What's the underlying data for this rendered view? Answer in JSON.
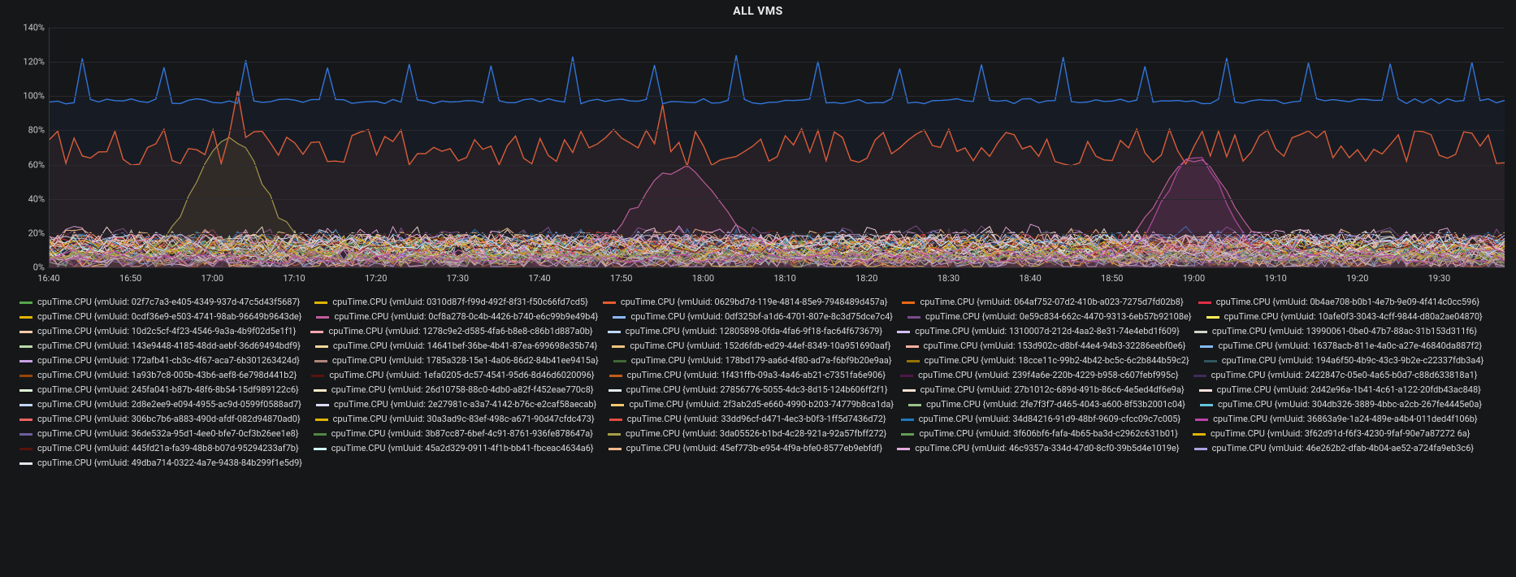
{
  "title": "ALL VMS",
  "chart_data": {
    "type": "line",
    "title": "ALL VMS",
    "xlabel": "",
    "ylabel": "",
    "x_is_time": true,
    "x_ticks": [
      "16:40",
      "16:50",
      "17:00",
      "17:10",
      "17:20",
      "17:30",
      "17:40",
      "17:50",
      "18:00",
      "18:10",
      "18:20",
      "18:30",
      "18:40",
      "18:50",
      "19:00",
      "19:10",
      "19:20",
      "19:30"
    ],
    "y_ticks": [
      "0%",
      "20%",
      "40%",
      "60%",
      "80%",
      "100%",
      "120%",
      "140%"
    ],
    "ylim": [
      0,
      140
    ],
    "xlim_minutes": [
      1000,
      1178
    ],
    "x_minutes": [
      1000,
      1001,
      1002,
      1003,
      1004,
      1005,
      1006,
      1007,
      1008,
      1009,
      1010,
      1011,
      1012,
      1013,
      1014,
      1015,
      1016,
      1017,
      1018,
      1019,
      1020,
      1021,
      1022,
      1023,
      1024,
      1025,
      1026,
      1027,
      1028,
      1029,
      1030,
      1031,
      1032,
      1033,
      1034,
      1035,
      1036,
      1037,
      1038,
      1039,
      1040,
      1041,
      1042,
      1043,
      1044,
      1045,
      1046,
      1047,
      1048,
      1049,
      1050,
      1051,
      1052,
      1053,
      1054,
      1055,
      1056,
      1057,
      1058,
      1059,
      1060,
      1061,
      1062,
      1063,
      1064,
      1065,
      1066,
      1067,
      1068,
      1069,
      1070,
      1071,
      1072,
      1073,
      1074,
      1075,
      1076,
      1077,
      1078,
      1079,
      1080,
      1081,
      1082,
      1083,
      1084,
      1085,
      1086,
      1087,
      1088,
      1089,
      1090,
      1091,
      1092,
      1093,
      1094,
      1095,
      1096,
      1097,
      1098,
      1099,
      1100,
      1101,
      1102,
      1103,
      1104,
      1105,
      1106,
      1107,
      1108,
      1109,
      1110,
      1111,
      1112,
      1113,
      1114,
      1115,
      1116,
      1117,
      1118,
      1119,
      1120,
      1121,
      1122,
      1123,
      1124,
      1125,
      1126,
      1127,
      1128,
      1129,
      1130,
      1131,
      1132,
      1133,
      1134,
      1135,
      1136,
      1137,
      1138,
      1139,
      1140,
      1141,
      1142,
      1143,
      1144,
      1145,
      1146,
      1147,
      1148,
      1149,
      1150,
      1151,
      1152,
      1153,
      1154,
      1155,
      1156,
      1157,
      1158,
      1159,
      1160,
      1161,
      1162,
      1163,
      1164,
      1165,
      1166,
      1167,
      1168,
      1169,
      1170,
      1171,
      1172,
      1173,
      1174,
      1175,
      1176,
      1177,
      1178
    ],
    "series": [
      {
        "name": "cpuTime.CPU {vmUuid: 02f7c7a3-e405-4349-937d-47c5d43f5687}",
        "color": "#56a64b",
        "kind": "blue"
      },
      {
        "name": "cpuTime.CPU {vmUuid: 0310d87f-f99d-492f-8f31-f50c66fd7cd5}",
        "color": "#e0b400",
        "kind": "noise"
      },
      {
        "name": "cpuTime.CPU {vmUuid: 0629bd7d-119e-4814-85e9-7948489d457a}",
        "color": "#e55b2f",
        "kind": "orange"
      },
      {
        "name": "cpuTime.CPU {vmUuid: 064af752-07d2-410b-a023-7275d7fd02b8}",
        "color": "#ea6a17",
        "kind": "noise"
      },
      {
        "name": "cpuTime.CPU {vmUuid: 0b4ae708-b0b1-4e7b-9e09-4f414c0cc596}",
        "color": "#e02f44",
        "kind": "noise"
      },
      {
        "name": "cpuTime.CPU {vmUuid: 0cdf36e9-e503-4741-98ab-96649b9643de}",
        "color": "#e0b400",
        "kind": "noise"
      },
      {
        "name": "cpuTime.CPU {vmUuid: 0cf8a278-0c4b-4426-b740-e6c99b9e49b4}",
        "color": "#c15c9c",
        "kind": "pink"
      },
      {
        "name": "cpuTime.CPU {vmUuid: 0df325bf-a1d6-4701-807e-8c3d75dce7c4}",
        "color": "#8ab8ff",
        "kind": "noise"
      },
      {
        "name": "cpuTime.CPU {vmUuid: 0e59c834-662c-4470-9313-6eb57b92108e}",
        "color": "#7b4b8b",
        "kind": "noise"
      },
      {
        "name": "cpuTime.CPU {vmUuid: 10afe0f3-3043-4cff-9844-d80a2ae04870}",
        "color": "#ffee52",
        "kind": "noise"
      },
      {
        "name": "cpuTime.CPU {vmUuid: 10d2c5cf-4f23-4546-9a3a-4b9f02d5e1f1}",
        "color": "#ffcbad",
        "kind": "noise"
      },
      {
        "name": "cpuTime.CPU {vmUuid: 1278c9e2-d585-4fa6-b8e8-c86b1d887a0b}",
        "color": "#ffa6b0",
        "kind": "noise"
      },
      {
        "name": "cpuTime.CPU {vmUuid: 12805898-0fda-4fa6-9f18-fac64f673679}",
        "color": "#c0d8ff",
        "kind": "noise"
      },
      {
        "name": "cpuTime.CPU {vmUuid: 1310007d-212d-4aa2-8e31-74e4ebd1f609}",
        "color": "#d6bfff",
        "kind": "noise"
      },
      {
        "name": "cpuTime.CPU {vmUuid: 13990061-0be0-47b7-88ac-31b153d311f6}",
        "color": "#d4d4ca",
        "kind": "noise"
      },
      {
        "name": "cpuTime.CPU {vmUuid: 143e9448-4185-48dd-aebf-36d69494bdf9}",
        "color": "#b7dbab",
        "kind": "noise"
      },
      {
        "name": "cpuTime.CPU {vmUuid: 14641bef-36be-4b41-87ea-699698e35b74}",
        "color": "#f4d598",
        "kind": "noise"
      },
      {
        "name": "cpuTime.CPU {vmUuid: 152d6fdb-ed29-44ef-8349-10a951690aaf}",
        "color": "#f4c47e",
        "kind": "noise"
      },
      {
        "name": "cpuTime.CPU {vmUuid: 153d902c-d8bf-44e4-94b3-32286eebf0e6}",
        "color": "#fdaf9f",
        "kind": "noise"
      },
      {
        "name": "cpuTime.CPU {vmUuid: 16378acb-811e-4a0c-a27e-46840da887f2}",
        "color": "#84baf3",
        "kind": "noise"
      },
      {
        "name": "cpuTime.CPU {vmUuid: 172afb41-cb3c-4f67-aca7-6b301263424d}",
        "color": "#c8a1e0",
        "kind": "noise"
      },
      {
        "name": "cpuTime.CPU {vmUuid: 1785a328-15e1-4a06-86d2-84b41ee9415a}",
        "color": "#b0867b",
        "kind": "noise"
      },
      {
        "name": "cpuTime.CPU {vmUuid: 178bd179-aa6d-4f80-ad7a-f6bf9b20e9aa}",
        "color": "#3f6833",
        "kind": "noise"
      },
      {
        "name": "cpuTime.CPU {vmUuid: 18cce11c-99b2-4b42-bc5c-6c2b844b59c2}",
        "color": "#967302",
        "kind": "noise"
      },
      {
        "name": "cpuTime.CPU {vmUuid: 194a6f50-4b9c-43c3-9b2e-c22337fdb3a4}",
        "color": "#2f575e",
        "kind": "noise"
      },
      {
        "name": "cpuTime.CPU {vmUuid: 1a93b7c8-005b-43b6-aef8-6e798d441b2}",
        "color": "#99440a",
        "kind": "noise"
      },
      {
        "name": "cpuTime.CPU {vmUuid: 1efa0205-dc57-4541-95d6-8d46d6020096}",
        "color": "#58140c",
        "kind": "noise"
      },
      {
        "name": "cpuTime.CPU {vmUuid: 1f431ffb-09a3-4a46-ab21-c7351fa6e906}",
        "color": "#c15c17",
        "kind": "noise"
      },
      {
        "name": "cpuTime.CPU {vmUuid: 239f4a6e-220b-4229-b958-c607febf995c}",
        "color": "#511749",
        "kind": "noise"
      },
      {
        "name": "cpuTime.CPU {vmUuid: 2422847c-05e0-4a65-b0d7-c88d633818a1}",
        "color": "#3f2b5b",
        "kind": "noise"
      },
      {
        "name": "cpuTime.CPU {vmUuid: 245fa041-b87b-48f6-8b54-15df989122c6}",
        "color": "#e0f9d7",
        "kind": "noise"
      },
      {
        "name": "cpuTime.CPU {vmUuid: 26d10758-88c0-4db0-a82f-f452eae770c8}",
        "color": "#fceaca",
        "kind": "noise"
      },
      {
        "name": "cpuTime.CPU {vmUuid: 27856776-5055-4dc3-8d15-124b606ff2f1}",
        "color": "#e3eded",
        "kind": "noise"
      },
      {
        "name": "cpuTime.CPU {vmUuid: 27b1012c-689d-491b-86c6-4e5ed4df6e9a}",
        "color": "#f9e2d2",
        "kind": "noise"
      },
      {
        "name": "cpuTime.CPU {vmUuid: 2d42e96a-1b41-4c61-a122-20fdb43ac848}",
        "color": "#fce2de",
        "kind": "noise"
      },
      {
        "name": "cpuTime.CPU {vmUuid: 2d8e2ee9-e094-4955-ac9d-0599f0588ad7}",
        "color": "#bed6f6",
        "kind": "noise"
      },
      {
        "name": "cpuTime.CPU {vmUuid: 2e27981c-a3a7-4142-b76c-e2caf58aecab}",
        "color": "#dedaf7",
        "kind": "noise"
      },
      {
        "name": "cpuTime.CPU {vmUuid: 2f3ab2d5-e660-4990-b203-74779b8ca1da}",
        "color": "#f2c96d",
        "kind": "noise"
      },
      {
        "name": "cpuTime.CPU {vmUuid: 2fe7f3f7-d465-4043-a600-8f53b2001c04}",
        "color": "#9ac48a",
        "kind": "noise"
      },
      {
        "name": "cpuTime.CPU {vmUuid: 304db326-3889-4bbc-a2cb-267fe4445e0a}",
        "color": "#65c5db",
        "kind": "noise"
      },
      {
        "name": "cpuTime.CPU {vmUuid: 306bc7b6-a883-490d-afdf-082d94870ad0}",
        "color": "#ea6460",
        "kind": "noise"
      },
      {
        "name": "cpuTime.CPU {vmUuid: 30a3ad9c-83ef-498c-a671-90d47cfdc473}",
        "color": "#e0b400",
        "kind": "noise"
      },
      {
        "name": "cpuTime.CPU {vmUuid: 33dd96cf-d471-4ec3-b0f3-1ff5d7436d72}",
        "color": "#e24d42",
        "kind": "noise"
      },
      {
        "name": "cpuTime.CPU {vmUuid: 34d84216-91d9-48bf-9609-cfcc09c7c005}",
        "color": "#1f78c1",
        "kind": "noise"
      },
      {
        "name": "cpuTime.CPU {vmUuid: 36863a9e-1a24-489e-a4b4-011ded4f106b}",
        "color": "#ba43a9",
        "kind": "spike2"
      },
      {
        "name": "cpuTime.CPU {vmUuid: 36de532a-95d1-4ee0-bfe7-0cf3b26ee1e8}",
        "color": "#705da0",
        "kind": "noise"
      },
      {
        "name": "cpuTime.CPU {vmUuid: 3b87cc87-6bef-4c91-8761-936fe878647a}",
        "color": "#508642",
        "kind": "noise"
      },
      {
        "name": "cpuTime.CPU {vmUuid: 3da05526-b1bd-4c28-921a-92a57fbff272}",
        "color": "#a49e45",
        "kind": "spike1"
      },
      {
        "name": "cpuTime.CPU {vmUuid: 3f606bf6-fafa-4b65-ba3d-c2962c631b01}",
        "color": "#629e51",
        "kind": "noise"
      },
      {
        "name": "cpuTime.CPU {vmUuid: 3f62d91d-f6f3-4230-9faf-90e7a87272 6a}",
        "color": "#e0b400",
        "kind": "noise"
      },
      {
        "name": "cpuTime.CPU {vmUuid: 445fd21a-fa39-48b8-b07d-95294233af7b}",
        "color": "#58140c",
        "kind": "noise"
      },
      {
        "name": "cpuTime.CPU {vmUuid: 45a2d329-0911-4f1b-bb41-fbceac4634a6}",
        "color": "#cffaff",
        "kind": "noise"
      },
      {
        "name": "cpuTime.CPU {vmUuid: 45ef773b-e954-4f9a-bfe0-8577eb9ebfdf}",
        "color": "#f9ba8f",
        "kind": "noise"
      },
      {
        "name": "cpuTime.CPU {vmUuid: 46c9357a-334d-47d0-8cf0-39b5d4e1019e}",
        "color": "#e5a8e2",
        "kind": "noise"
      },
      {
        "name": "cpuTime.CPU {vmUuid: 46e262b2-dfab-4b04-ae52-a724fa9eb3c6}",
        "color": "#aea2e0",
        "kind": "noise"
      },
      {
        "name": "cpuTime.CPU {vmUuid: 49dba714-0322-4a7e-9438-84b299f1e5d9}",
        "color": "#e4e4ee",
        "kind": "noise"
      }
    ]
  }
}
